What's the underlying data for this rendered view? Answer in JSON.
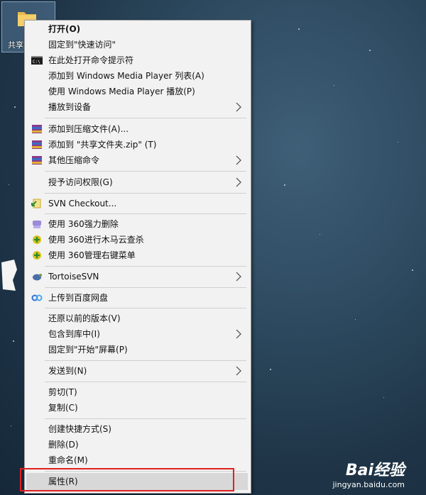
{
  "desktop": {
    "icon_label": "共享文"
  },
  "menu": {
    "items": [
      {
        "label": "打开(O)",
        "bold": true
      },
      {
        "label": "固定到\"快速访问\""
      },
      {
        "label": "在此处打开命令提示符"
      },
      {
        "label": "添加到 Windows Media Player 列表(A)"
      },
      {
        "label": "使用 Windows Media Player 播放(P)"
      },
      {
        "label": "播放到设备"
      },
      {
        "label": "添加到压缩文件(A)..."
      },
      {
        "label": "添加到 \"共享文件夹.zip\" (T)"
      },
      {
        "label": "其他压缩命令"
      },
      {
        "label": "授予访问权限(G)"
      },
      {
        "label": "SVN Checkout..."
      },
      {
        "label": "使用 360强力删除"
      },
      {
        "label": "使用 360进行木马云查杀"
      },
      {
        "label": "使用 360管理右键菜单"
      },
      {
        "label": "TortoiseSVN"
      },
      {
        "label": "上传到百度网盘"
      },
      {
        "label": "还原以前的版本(V)"
      },
      {
        "label": "包含到库中(I)"
      },
      {
        "label": "固定到\"开始\"屏幕(P)"
      },
      {
        "label": "发送到(N)"
      },
      {
        "label": "剪切(T)"
      },
      {
        "label": "复制(C)"
      },
      {
        "label": "创建快捷方式(S)"
      },
      {
        "label": "删除(D)"
      },
      {
        "label": "重命名(M)"
      },
      {
        "label": "属性(R)"
      }
    ]
  },
  "watermark": {
    "logo": "Bai经验",
    "url": "jingyan.baidu.com"
  }
}
